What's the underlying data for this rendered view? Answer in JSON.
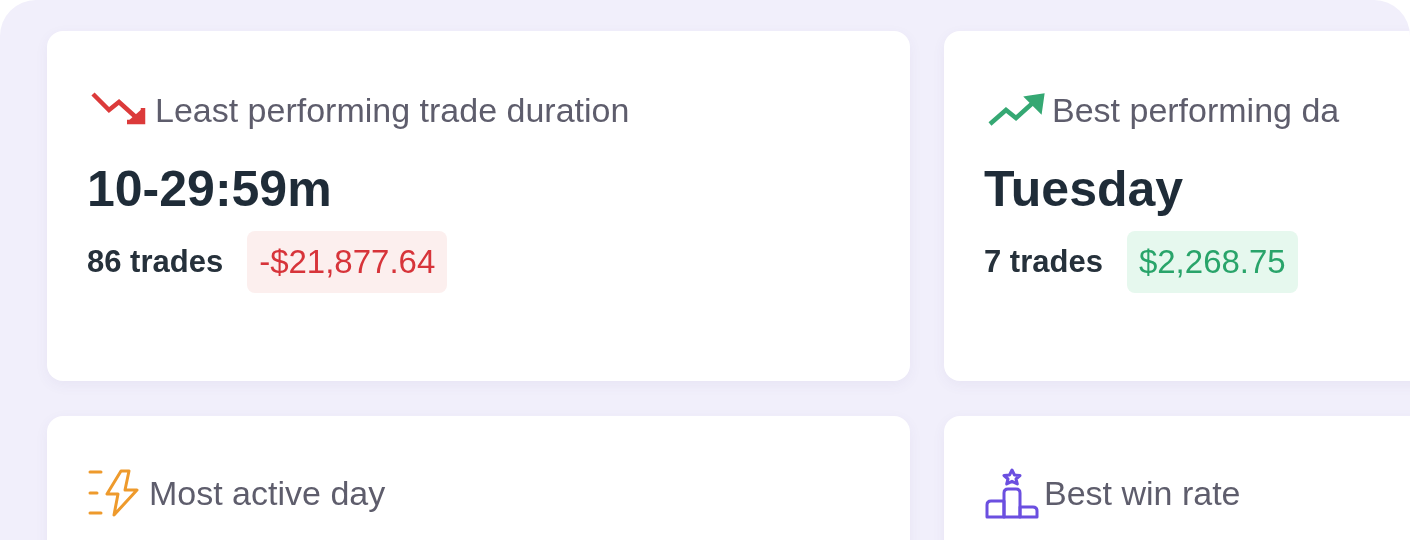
{
  "cards": [
    {
      "kind": "loss",
      "title": "Least performing trade duration",
      "value": "10-29:59m",
      "trades": "86 trades",
      "pnl": {
        "kind": "loss",
        "text": "-$21,877.64"
      }
    },
    {
      "kind": "gain",
      "title": "Best performing da",
      "value": "Tuesday",
      "trades": "7 trades",
      "pnl": {
        "kind": "gain",
        "text": "$2,268.75"
      }
    },
    {
      "kind": "activity",
      "title": "Most active day"
    },
    {
      "kind": "winrate",
      "title": "Best win rate"
    }
  ]
}
